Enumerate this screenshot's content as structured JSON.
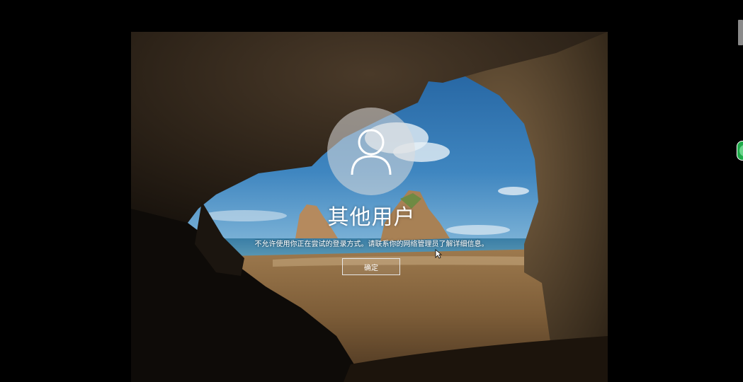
{
  "lock_screen": {
    "username": "其他用户",
    "message": "不允许使用你正在尝试的登录方式。请联系你的网络管理员了解详细信息。",
    "ok_label": "确定",
    "avatar_icon": "user-silhouette-icon"
  },
  "colors": {
    "text": "#ffffff",
    "avatar_bg": "#c8c8c8",
    "button_border": "#e8e8e8",
    "side_badge": "#1faa4a"
  }
}
